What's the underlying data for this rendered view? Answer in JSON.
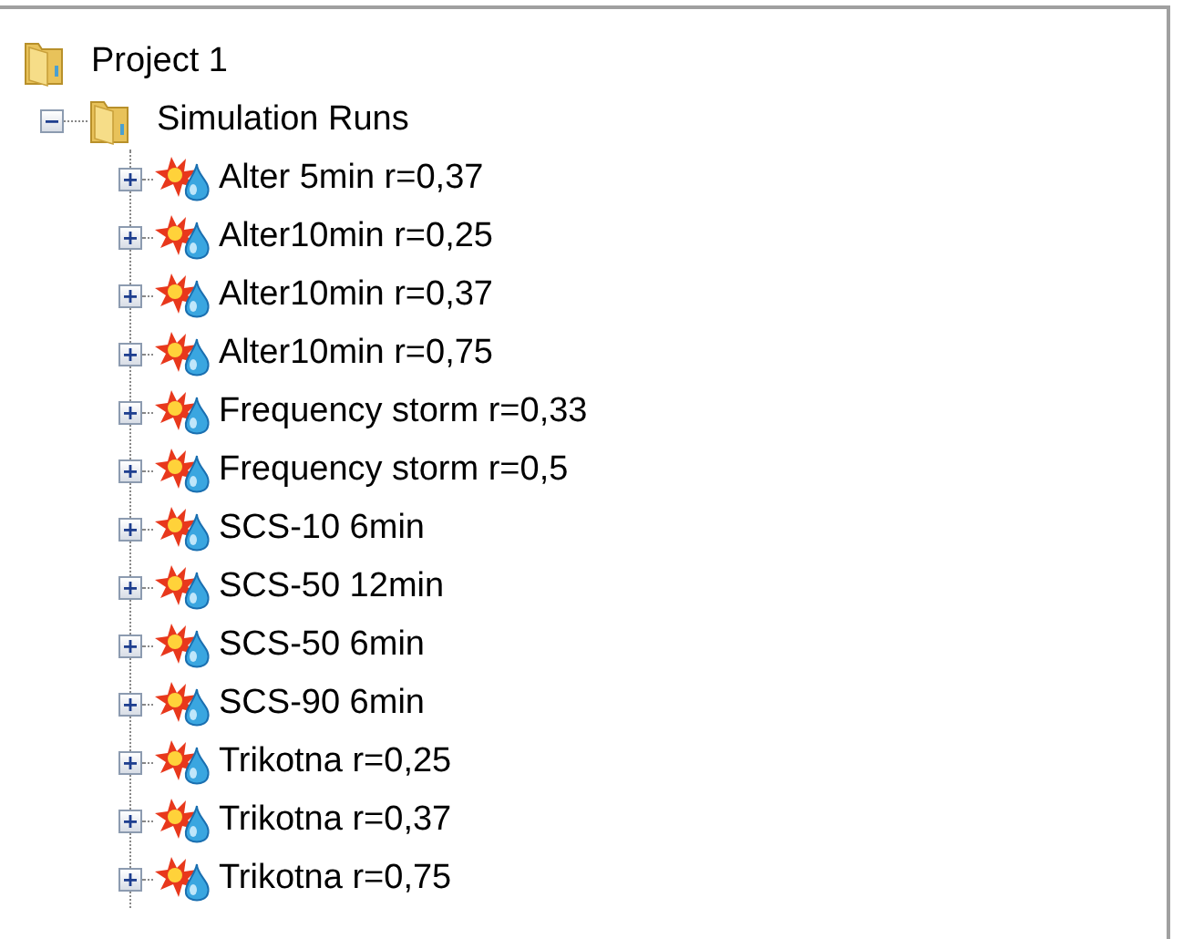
{
  "tree": {
    "label": "Project 1",
    "children": [
      {
        "label": "Simulation Runs",
        "expanded": true,
        "children": [
          {
            "label": "Alter 5min r=0,37",
            "expanded": false
          },
          {
            "label": "Alter10min r=0,25",
            "expanded": false
          },
          {
            "label": "Alter10min r=0,37",
            "expanded": false
          },
          {
            "label": "Alter10min r=0,75",
            "expanded": false
          },
          {
            "label": "Frequency storm r=0,33",
            "expanded": false
          },
          {
            "label": "Frequency storm r=0,5",
            "expanded": false
          },
          {
            "label": "SCS-10 6min",
            "expanded": false
          },
          {
            "label": "SCS-50 12min",
            "expanded": false
          },
          {
            "label": "SCS-50 6min",
            "expanded": false
          },
          {
            "label": "SCS-90 6min",
            "expanded": false
          },
          {
            "label": "Trikotna r=0,25",
            "expanded": false
          },
          {
            "label": "Trikotna r=0,37",
            "expanded": false
          },
          {
            "label": "Trikotna r=0,75",
            "expanded": false
          }
        ]
      }
    ]
  }
}
